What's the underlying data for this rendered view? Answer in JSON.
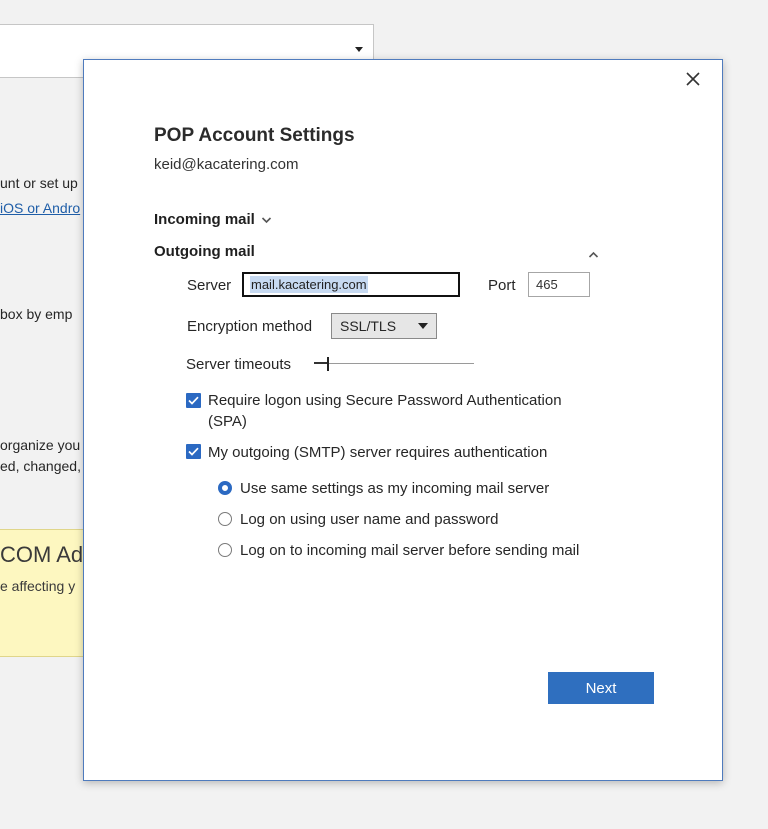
{
  "background": {
    "lines": [
      {
        "text": "unt or set up",
        "link": false
      },
      {
        "text": "iOS or Andro",
        "link": true
      },
      {
        "text": "box by emp",
        "link": false
      },
      {
        "text": "organize you",
        "link": false
      },
      {
        "text": "ed, changed,",
        "link": false
      }
    ],
    "banner_title": "COM Ad",
    "banner_text": "e affecting y"
  },
  "dialog": {
    "title": "POP Account Settings",
    "email": "keid@kacatering.com",
    "incoming_label": "Incoming mail",
    "outgoing_label": "Outgoing mail",
    "server_label": "Server",
    "server_value": "mail.kacatering.com",
    "port_label": "Port",
    "port_value": "465",
    "encryption_label": "Encryption method",
    "encryption_value": "SSL/TLS",
    "timeout_label": "Server timeouts",
    "timeout_level": 0.08,
    "spa_label": "Require logon using Secure Password Authentication (SPA)",
    "spa_checked": true,
    "smtp_auth_label": "My outgoing (SMTP) server requires authentication",
    "smtp_auth_checked": true,
    "radio_options": [
      {
        "label": "Use same settings as my incoming mail server",
        "selected": true
      },
      {
        "label": "Log on using user name and password",
        "selected": false
      },
      {
        "label": "Log on to incoming mail server before sending mail",
        "selected": false
      }
    ],
    "next_label": "Next"
  },
  "colors": {
    "accent": "#2b69c2",
    "button": "#2f6fbf",
    "selection": "#c7daf2",
    "banner": "#fdf7c0"
  }
}
